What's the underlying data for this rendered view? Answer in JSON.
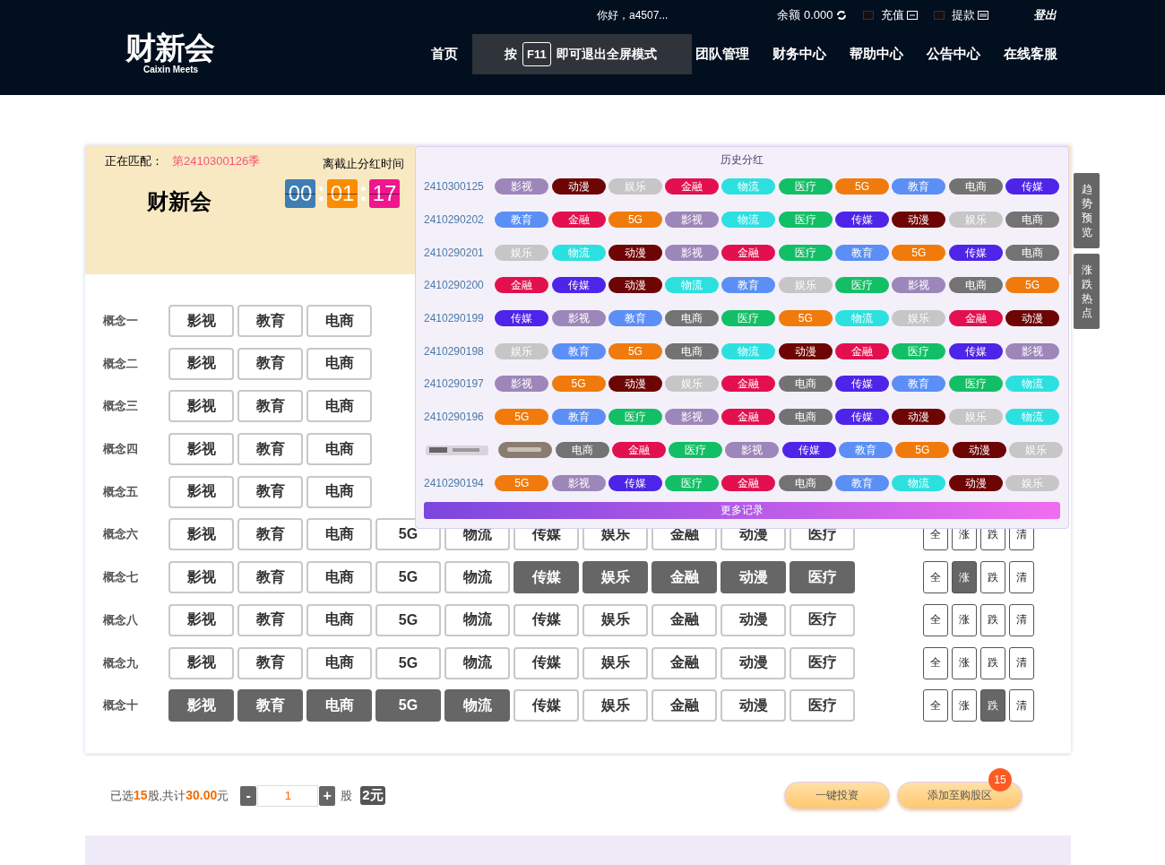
{
  "header": {
    "logo": "财新会",
    "logo_subtitle": "Caixin Meets",
    "greeting": "你好，a4507...",
    "balance": "余额 0.000",
    "recharge": "充值",
    "withdraw": "提款",
    "logout": "登出",
    "nav": [
      "首页",
      "团队管理",
      "财务中心",
      "帮助中心",
      "公告中心",
      "在线客服"
    ],
    "toast": {
      "before": "按",
      "key": "F11",
      "after": "即可退出全屏模式"
    }
  },
  "match": {
    "label": "正在匹配：",
    "period": "第2410300126季",
    "title": "财新会",
    "countdown_label": "离截止分红时间",
    "countdown": [
      {
        "value": "00",
        "color": "#3f7db3"
      },
      {
        "value": "01",
        "color": "#fb8c00"
      },
      {
        "value": "17",
        "color": "#f0168d"
      }
    ]
  },
  "concepts": [
    {
      "label": "概念一",
      "options": [
        {
          "label": "影视",
          "selected": false
        },
        {
          "label": "教育",
          "selected": false
        },
        {
          "label": "电商",
          "selected": false
        }
      ]
    },
    {
      "label": "概念二",
      "options": [
        {
          "label": "影视",
          "selected": false
        },
        {
          "label": "教育",
          "selected": false
        },
        {
          "label": "电商",
          "selected": false
        }
      ]
    },
    {
      "label": "概念三",
      "options": [
        {
          "label": "影视",
          "selected": false
        },
        {
          "label": "教育",
          "selected": false
        },
        {
          "label": "电商",
          "selected": false
        }
      ]
    },
    {
      "label": "概念四",
      "options": [
        {
          "label": "影视",
          "selected": false
        },
        {
          "label": "教育",
          "selected": false
        },
        {
          "label": "电商",
          "selected": false
        }
      ]
    },
    {
      "label": "概念五",
      "options": [
        {
          "label": "影视",
          "selected": false
        },
        {
          "label": "教育",
          "selected": false
        },
        {
          "label": "电商",
          "selected": false
        }
      ]
    },
    {
      "label": "概念六",
      "options": [
        {
          "label": "影视",
          "selected": false
        },
        {
          "label": "教育",
          "selected": false
        },
        {
          "label": "电商",
          "selected": false
        },
        {
          "label": "5G",
          "selected": false
        },
        {
          "label": "物流",
          "selected": false
        },
        {
          "label": "传媒",
          "selected": false
        },
        {
          "label": "娱乐",
          "selected": false
        },
        {
          "label": "金融",
          "selected": false
        },
        {
          "label": "动漫",
          "selected": false
        },
        {
          "label": "医疗",
          "selected": false
        }
      ],
      "tools": [
        {
          "label": "全",
          "selected": false
        },
        {
          "label": "涨",
          "selected": false
        },
        {
          "label": "跌",
          "selected": false
        },
        {
          "label": "清",
          "selected": false
        }
      ]
    },
    {
      "label": "概念七",
      "options": [
        {
          "label": "影视",
          "selected": false
        },
        {
          "label": "教育",
          "selected": false
        },
        {
          "label": "电商",
          "selected": false
        },
        {
          "label": "5G",
          "selected": false
        },
        {
          "label": "物流",
          "selected": false
        },
        {
          "label": "传媒",
          "selected": true
        },
        {
          "label": "娱乐",
          "selected": true
        },
        {
          "label": "金融",
          "selected": true
        },
        {
          "label": "动漫",
          "selected": true
        },
        {
          "label": "医疗",
          "selected": true
        }
      ],
      "tools": [
        {
          "label": "全",
          "selected": false
        },
        {
          "label": "涨",
          "selected": true
        },
        {
          "label": "跌",
          "selected": false
        },
        {
          "label": "清",
          "selected": false
        }
      ]
    },
    {
      "label": "概念八",
      "options": [
        {
          "label": "影视",
          "selected": false
        },
        {
          "label": "教育",
          "selected": false
        },
        {
          "label": "电商",
          "selected": false
        },
        {
          "label": "5G",
          "selected": false
        },
        {
          "label": "物流",
          "selected": false
        },
        {
          "label": "传媒",
          "selected": false
        },
        {
          "label": "娱乐",
          "selected": false
        },
        {
          "label": "金融",
          "selected": false
        },
        {
          "label": "动漫",
          "selected": false
        },
        {
          "label": "医疗",
          "selected": false
        }
      ],
      "tools": [
        {
          "label": "全",
          "selected": false
        },
        {
          "label": "涨",
          "selected": false
        },
        {
          "label": "跌",
          "selected": false
        },
        {
          "label": "清",
          "selected": false
        }
      ]
    },
    {
      "label": "概念九",
      "options": [
        {
          "label": "影视",
          "selected": false
        },
        {
          "label": "教育",
          "selected": false
        },
        {
          "label": "电商",
          "selected": false
        },
        {
          "label": "5G",
          "selected": false
        },
        {
          "label": "物流",
          "selected": false
        },
        {
          "label": "传媒",
          "selected": false
        },
        {
          "label": "娱乐",
          "selected": false
        },
        {
          "label": "金融",
          "selected": false
        },
        {
          "label": "动漫",
          "selected": false
        },
        {
          "label": "医疗",
          "selected": false
        }
      ],
      "tools": [
        {
          "label": "全",
          "selected": false
        },
        {
          "label": "涨",
          "selected": false
        },
        {
          "label": "跌",
          "selected": false
        },
        {
          "label": "清",
          "selected": false
        }
      ]
    },
    {
      "label": "概念十",
      "options": [
        {
          "label": "影视",
          "selected": true
        },
        {
          "label": "教育",
          "selected": true
        },
        {
          "label": "电商",
          "selected": true
        },
        {
          "label": "5G",
          "selected": true
        },
        {
          "label": "物流",
          "selected": true
        },
        {
          "label": "传媒",
          "selected": false
        },
        {
          "label": "娱乐",
          "selected": false
        },
        {
          "label": "金融",
          "selected": false
        },
        {
          "label": "动漫",
          "selected": false
        },
        {
          "label": "医疗",
          "selected": false
        }
      ],
      "tools": [
        {
          "label": "全",
          "selected": false
        },
        {
          "label": "涨",
          "selected": false
        },
        {
          "label": "跌",
          "selected": true
        },
        {
          "label": "清",
          "selected": false
        }
      ]
    }
  ],
  "history": {
    "title": "历史分红",
    "more": "更多记录",
    "rows": [
      {
        "id": "2410300125",
        "tags": [
          {
            "label": "影视",
            "color": "#9d86b9"
          },
          {
            "label": "动漫",
            "color": "#6e0505"
          },
          {
            "label": "娱乐",
            "color": "#c6c6c6"
          },
          {
            "label": "金融",
            "color": "#e3104f"
          },
          {
            "label": "物流",
            "color": "#2ce0e0"
          },
          {
            "label": "医疗",
            "color": "#13bf66"
          },
          {
            "label": "5G",
            "color": "#f07b0c"
          },
          {
            "label": "教育",
            "color": "#5b8ff5"
          },
          {
            "label": "电商",
            "color": "#737373"
          },
          {
            "label": "传媒",
            "color": "#4e24e8"
          }
        ]
      },
      {
        "id": "2410290202",
        "tags": [
          {
            "label": "教育",
            "color": "#5b8ff5"
          },
          {
            "label": "金融",
            "color": "#e3104f"
          },
          {
            "label": "5G",
            "color": "#f07b0c"
          },
          {
            "label": "影视",
            "color": "#9d86b9"
          },
          {
            "label": "物流",
            "color": "#2ce0e0"
          },
          {
            "label": "医疗",
            "color": "#13bf66"
          },
          {
            "label": "传媒",
            "color": "#4e24e8"
          },
          {
            "label": "动漫",
            "color": "#6e0505"
          },
          {
            "label": "娱乐",
            "color": "#c6c6c6"
          },
          {
            "label": "电商",
            "color": "#737373"
          }
        ]
      },
      {
        "id": "2410290201",
        "tags": [
          {
            "label": "娱乐",
            "color": "#c6c6c6"
          },
          {
            "label": "物流",
            "color": "#2ce0e0"
          },
          {
            "label": "动漫",
            "color": "#6e0505"
          },
          {
            "label": "影视",
            "color": "#9d86b9"
          },
          {
            "label": "金融",
            "color": "#e3104f"
          },
          {
            "label": "医疗",
            "color": "#13bf66"
          },
          {
            "label": "教育",
            "color": "#5b8ff5"
          },
          {
            "label": "5G",
            "color": "#f07b0c"
          },
          {
            "label": "传媒",
            "color": "#4e24e8"
          },
          {
            "label": "电商",
            "color": "#737373"
          }
        ]
      },
      {
        "id": "2410290200",
        "tags": [
          {
            "label": "金融",
            "color": "#e3104f"
          },
          {
            "label": "传媒",
            "color": "#4e24e8"
          },
          {
            "label": "动漫",
            "color": "#6e0505"
          },
          {
            "label": "物流",
            "color": "#2ce0e0"
          },
          {
            "label": "教育",
            "color": "#5b8ff5"
          },
          {
            "label": "娱乐",
            "color": "#c6c6c6"
          },
          {
            "label": "医疗",
            "color": "#13bf66"
          },
          {
            "label": "影视",
            "color": "#9d86b9"
          },
          {
            "label": "电商",
            "color": "#737373"
          },
          {
            "label": "5G",
            "color": "#f07b0c"
          }
        ]
      },
      {
        "id": "2410290199",
        "tags": [
          {
            "label": "传媒",
            "color": "#4e24e8"
          },
          {
            "label": "影视",
            "color": "#9d86b9"
          },
          {
            "label": "教育",
            "color": "#5b8ff5"
          },
          {
            "label": "电商",
            "color": "#737373"
          },
          {
            "label": "医疗",
            "color": "#13bf66"
          },
          {
            "label": "5G",
            "color": "#f07b0c"
          },
          {
            "label": "物流",
            "color": "#2ce0e0"
          },
          {
            "label": "娱乐",
            "color": "#c6c6c6"
          },
          {
            "label": "金融",
            "color": "#e3104f"
          },
          {
            "label": "动漫",
            "color": "#6e0505"
          }
        ]
      },
      {
        "id": "2410290198",
        "tags": [
          {
            "label": "娱乐",
            "color": "#c6c6c6"
          },
          {
            "label": "教育",
            "color": "#5b8ff5"
          },
          {
            "label": "5G",
            "color": "#f07b0c"
          },
          {
            "label": "电商",
            "color": "#737373"
          },
          {
            "label": "物流",
            "color": "#2ce0e0"
          },
          {
            "label": "动漫",
            "color": "#6e0505"
          },
          {
            "label": "金融",
            "color": "#e3104f"
          },
          {
            "label": "医疗",
            "color": "#13bf66"
          },
          {
            "label": "传媒",
            "color": "#4e24e8"
          },
          {
            "label": "影视",
            "color": "#9d86b9"
          }
        ]
      },
      {
        "id": "2410290197",
        "tags": [
          {
            "label": "影视",
            "color": "#9d86b9"
          },
          {
            "label": "5G",
            "color": "#f07b0c"
          },
          {
            "label": "动漫",
            "color": "#6e0505"
          },
          {
            "label": "娱乐",
            "color": "#c6c6c6"
          },
          {
            "label": "金融",
            "color": "#e3104f"
          },
          {
            "label": "电商",
            "color": "#737373"
          },
          {
            "label": "传媒",
            "color": "#4e24e8"
          },
          {
            "label": "教育",
            "color": "#5b8ff5"
          },
          {
            "label": "医疗",
            "color": "#13bf66"
          },
          {
            "label": "物流",
            "color": "#2ce0e0"
          }
        ]
      },
      {
        "id": "2410290196",
        "tags": [
          {
            "label": "5G",
            "color": "#f07b0c"
          },
          {
            "label": "教育",
            "color": "#5b8ff5"
          },
          {
            "label": "医疗",
            "color": "#13bf66"
          },
          {
            "label": "影视",
            "color": "#9d86b9"
          },
          {
            "label": "金融",
            "color": "#e3104f"
          },
          {
            "label": "电商",
            "color": "#737373"
          },
          {
            "label": "传媒",
            "color": "#4e24e8"
          },
          {
            "label": "动漫",
            "color": "#6e0505"
          },
          {
            "label": "娱乐",
            "color": "#c6c6c6"
          },
          {
            "label": "物流",
            "color": "#2ce0e0"
          }
        ]
      },
      {
        "kind": "obscured",
        "tags": [
          {
            "label": "电商",
            "color": "#737373"
          },
          {
            "label": "金融",
            "color": "#e3104f"
          },
          {
            "label": "医疗",
            "color": "#13bf66"
          },
          {
            "label": "影视",
            "color": "#9d86b9"
          },
          {
            "label": "传媒",
            "color": "#4e24e8"
          },
          {
            "label": "教育",
            "color": "#5b8ff5"
          },
          {
            "label": "5G",
            "color": "#f07b0c"
          },
          {
            "label": "动漫",
            "color": "#6e0505"
          },
          {
            "label": "娱乐",
            "color": "#c6c6c6"
          }
        ]
      },
      {
        "id": "2410290194",
        "tags": [
          {
            "label": "5G",
            "color": "#f07b0c"
          },
          {
            "label": "影视",
            "color": "#9d86b9"
          },
          {
            "label": "传媒",
            "color": "#4e24e8"
          },
          {
            "label": "医疗",
            "color": "#13bf66"
          },
          {
            "label": "金融",
            "color": "#e3104f"
          },
          {
            "label": "电商",
            "color": "#737373"
          },
          {
            "label": "教育",
            "color": "#5b8ff5"
          },
          {
            "label": "物流",
            "color": "#2ce0e0"
          },
          {
            "label": "动漫",
            "color": "#6e0505"
          },
          {
            "label": "娱乐",
            "color": "#c6c6c6"
          }
        ]
      }
    ]
  },
  "side_tabs": [
    "趋势预览",
    "涨跌热点"
  ],
  "order": {
    "summary": "已选**15**股,共计**30.00**元",
    "minus": "-",
    "quantity": "1",
    "plus": "+",
    "unit": "股",
    "price": "2元",
    "invest": "一键投资",
    "add": "添加至购股区",
    "add_count": "15"
  }
}
